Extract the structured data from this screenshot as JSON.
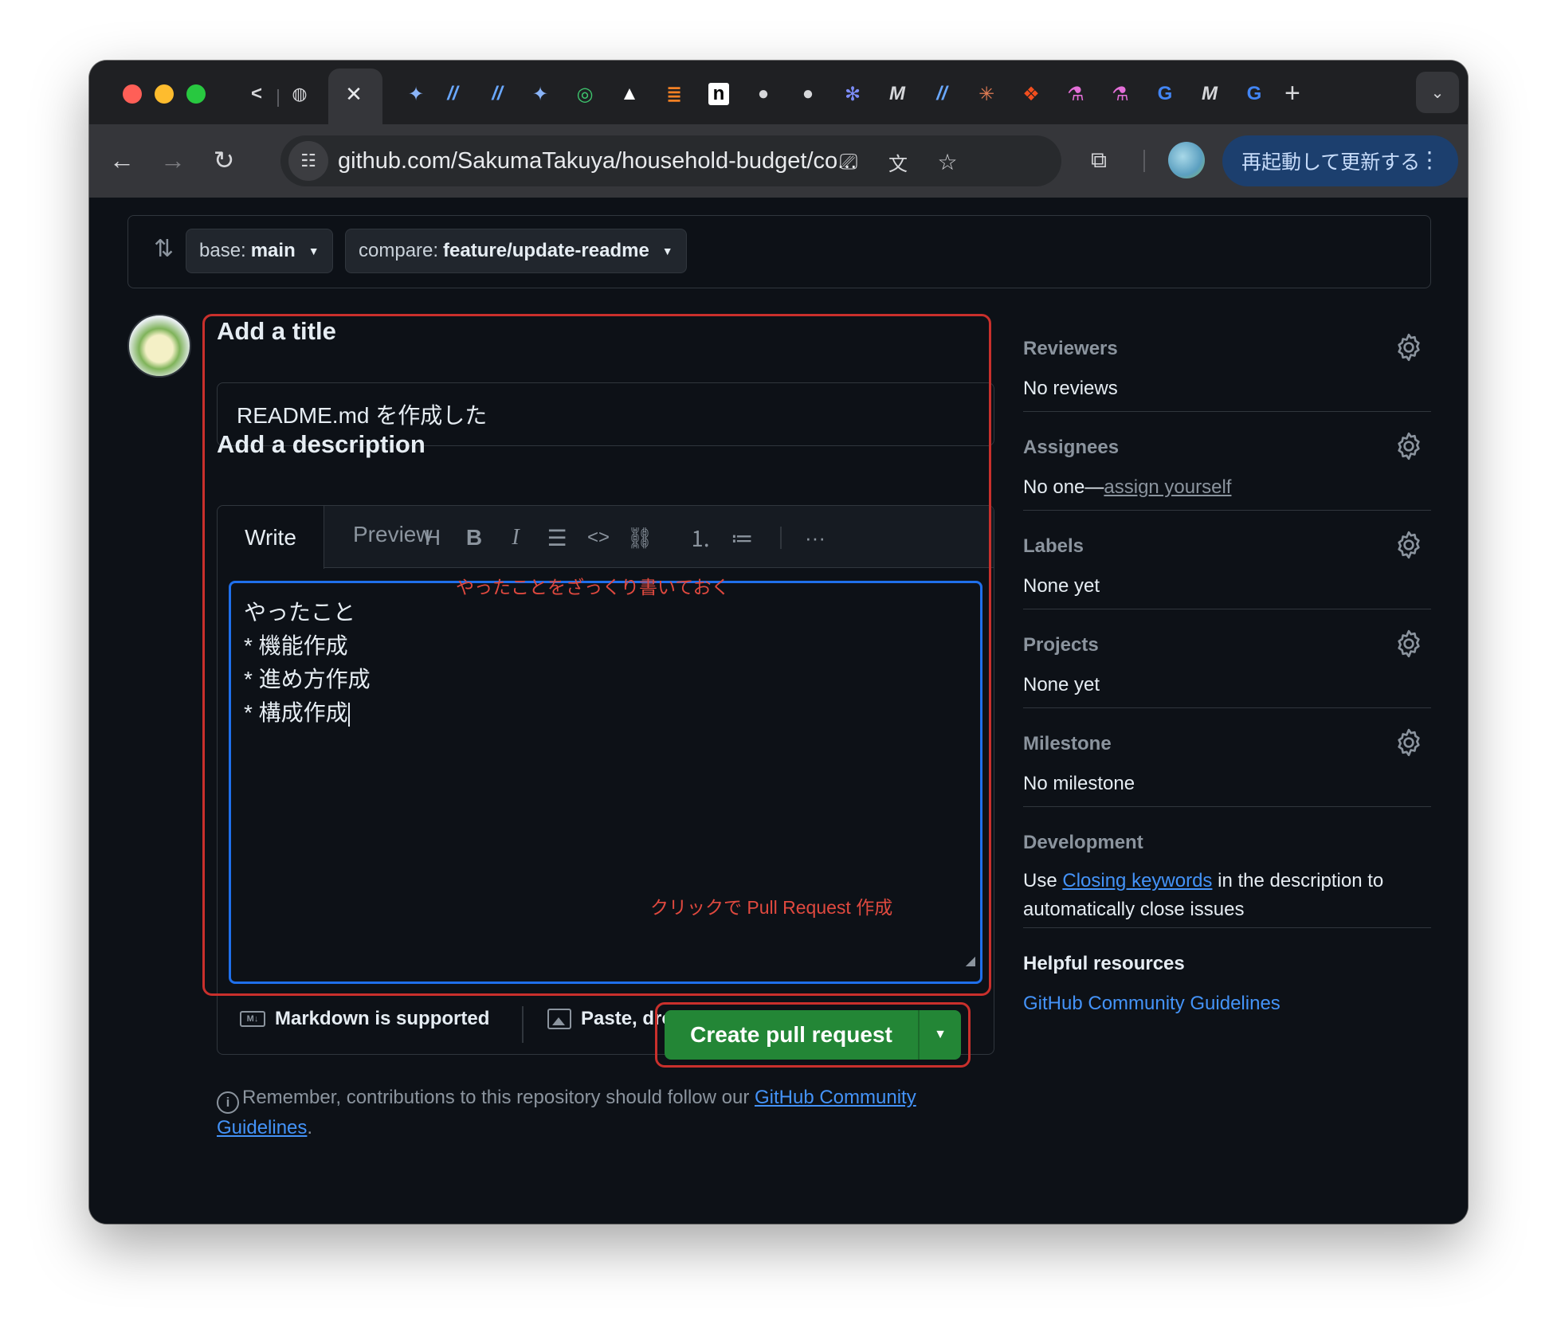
{
  "browser": {
    "url": "github.com/SakumaTakuya/household-budget/co...",
    "update_button": "再起動して更新する",
    "tab_icons": [
      "back-nav-tab-icon",
      "globe-icon",
      "close-icon",
      "gemini-icon",
      "slash-icon",
      "slash-icon",
      "gemini-icon",
      "chatgpt-icon",
      "triangle-icon",
      "stack-icon",
      "notion-icon",
      "github-icon",
      "github-icon",
      "slack-icon",
      "m-icon",
      "slash-icon",
      "claude-icon",
      "figma-icon",
      "lab-icon",
      "lab-icon",
      "google-icon",
      "m-icon",
      "google-icon"
    ]
  },
  "compare": {
    "base_label": "base:",
    "base_value": "main",
    "compare_label": "compare:",
    "compare_value": "feature/update-readme"
  },
  "form": {
    "title_heading": "Add a title",
    "title_value": "README.md を作成した",
    "description_heading": "Add a description",
    "tab_write": "Write",
    "tab_preview": "Preview",
    "description_lines": [
      "やったこと",
      "* 機能作成",
      "* 進め方作成",
      "* 構成作成"
    ],
    "markdown_note": "Markdown is supported",
    "files_note": "Paste, drop, or click to add files",
    "create_button": "Create pull request",
    "remember_text": "Remember, contributions to this repository should follow our ",
    "remember_link": "GitHub Community Guidelines",
    "remember_end": "."
  },
  "annotations": {
    "description_note": "やったことをざっくり書いておく",
    "button_note": "クリックで Pull Request 作成"
  },
  "sidebar": {
    "reviewers": {
      "title": "Reviewers",
      "value": "No reviews"
    },
    "assignees": {
      "title": "Assignees",
      "value_prefix": "No one—",
      "value_link": "assign yourself"
    },
    "labels": {
      "title": "Labels",
      "value": "None yet"
    },
    "projects": {
      "title": "Projects",
      "value": "None yet"
    },
    "milestone": {
      "title": "Milestone",
      "value": "No milestone"
    },
    "development": {
      "title": "Development",
      "text_before": "Use ",
      "link": "Closing keywords",
      "text_after": " in the description to",
      "text_line2": "automatically close issues"
    },
    "helpful": {
      "title": "Helpful resources",
      "link": "GitHub Community Guidelines"
    }
  },
  "colors": {
    "accent_green": "#238636",
    "focus_blue": "#1f6feb",
    "annotation_red": "#c9302c",
    "link_blue": "#4493f8"
  }
}
